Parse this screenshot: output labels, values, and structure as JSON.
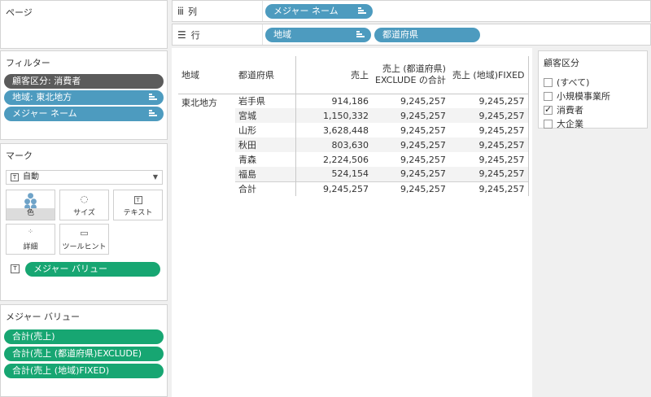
{
  "pages_panel": {
    "title": "ページ"
  },
  "columns_shelf": {
    "label": "列",
    "pills": [
      {
        "label": "メジャー ネーム"
      }
    ]
  },
  "rows_shelf": {
    "label": "行",
    "pills": [
      {
        "label": "地域"
      },
      {
        "label": "都道府県"
      }
    ]
  },
  "filters_panel": {
    "title": "フィルター",
    "pills": [
      {
        "label": "顧客区分: 消費者"
      },
      {
        "label": "地域: 東北地方"
      },
      {
        "label": "メジャー ネーム"
      }
    ]
  },
  "marks_panel": {
    "title": "マーク",
    "mark_type": "自動",
    "buttons": {
      "color": "色",
      "size": "サイズ",
      "text": "テキスト",
      "detail": "詳細",
      "tooltip": "ツールヒント"
    },
    "text_pill": "メジャー バリュー"
  },
  "measure_values_panel": {
    "title": "メジャー バリュー",
    "pills": [
      {
        "label": "合計(売上)"
      },
      {
        "label": "合計(売上 (都道府県)EXCLUDE)"
      },
      {
        "label": "合計(売上 (地域)FIXED)"
      }
    ]
  },
  "table": {
    "headers": {
      "region": "地域",
      "prefecture": "都道府県",
      "sales": "売上",
      "exclude_line1": "売上 (都道府県)",
      "exclude_line2": "EXCLUDE の合計",
      "fixed": "売上 (地域)FIXED"
    },
    "region": "東北地方",
    "rows": [
      {
        "pref": "岩手県",
        "sales": "914,186",
        "exclude": "9,245,257",
        "fixed": "9,245,257"
      },
      {
        "pref": "宮城",
        "sales": "1,150,332",
        "exclude": "9,245,257",
        "fixed": "9,245,257"
      },
      {
        "pref": "山形",
        "sales": "3,628,448",
        "exclude": "9,245,257",
        "fixed": "9,245,257"
      },
      {
        "pref": "秋田",
        "sales": "803,630",
        "exclude": "9,245,257",
        "fixed": "9,245,257"
      },
      {
        "pref": "青森",
        "sales": "2,224,506",
        "exclude": "9,245,257",
        "fixed": "9,245,257"
      },
      {
        "pref": "福島",
        "sales": "524,154",
        "exclude": "9,245,257",
        "fixed": "9,245,257"
      }
    ],
    "total": {
      "label": "合計",
      "sales": "9,245,257",
      "exclude": "9,245,257",
      "fixed": "9,245,257"
    }
  },
  "customer_segment": {
    "title": "顧客区分",
    "items": [
      {
        "label": "(すべて)",
        "checked": false
      },
      {
        "label": "小規模事業所",
        "checked": false
      },
      {
        "label": "消費者",
        "checked": true
      },
      {
        "label": "大企業",
        "checked": false
      }
    ]
  },
  "colors": {
    "blue_pill": "#4d9bbf",
    "green_pill": "#17a672",
    "gray_pill": "#5b5b5b"
  }
}
